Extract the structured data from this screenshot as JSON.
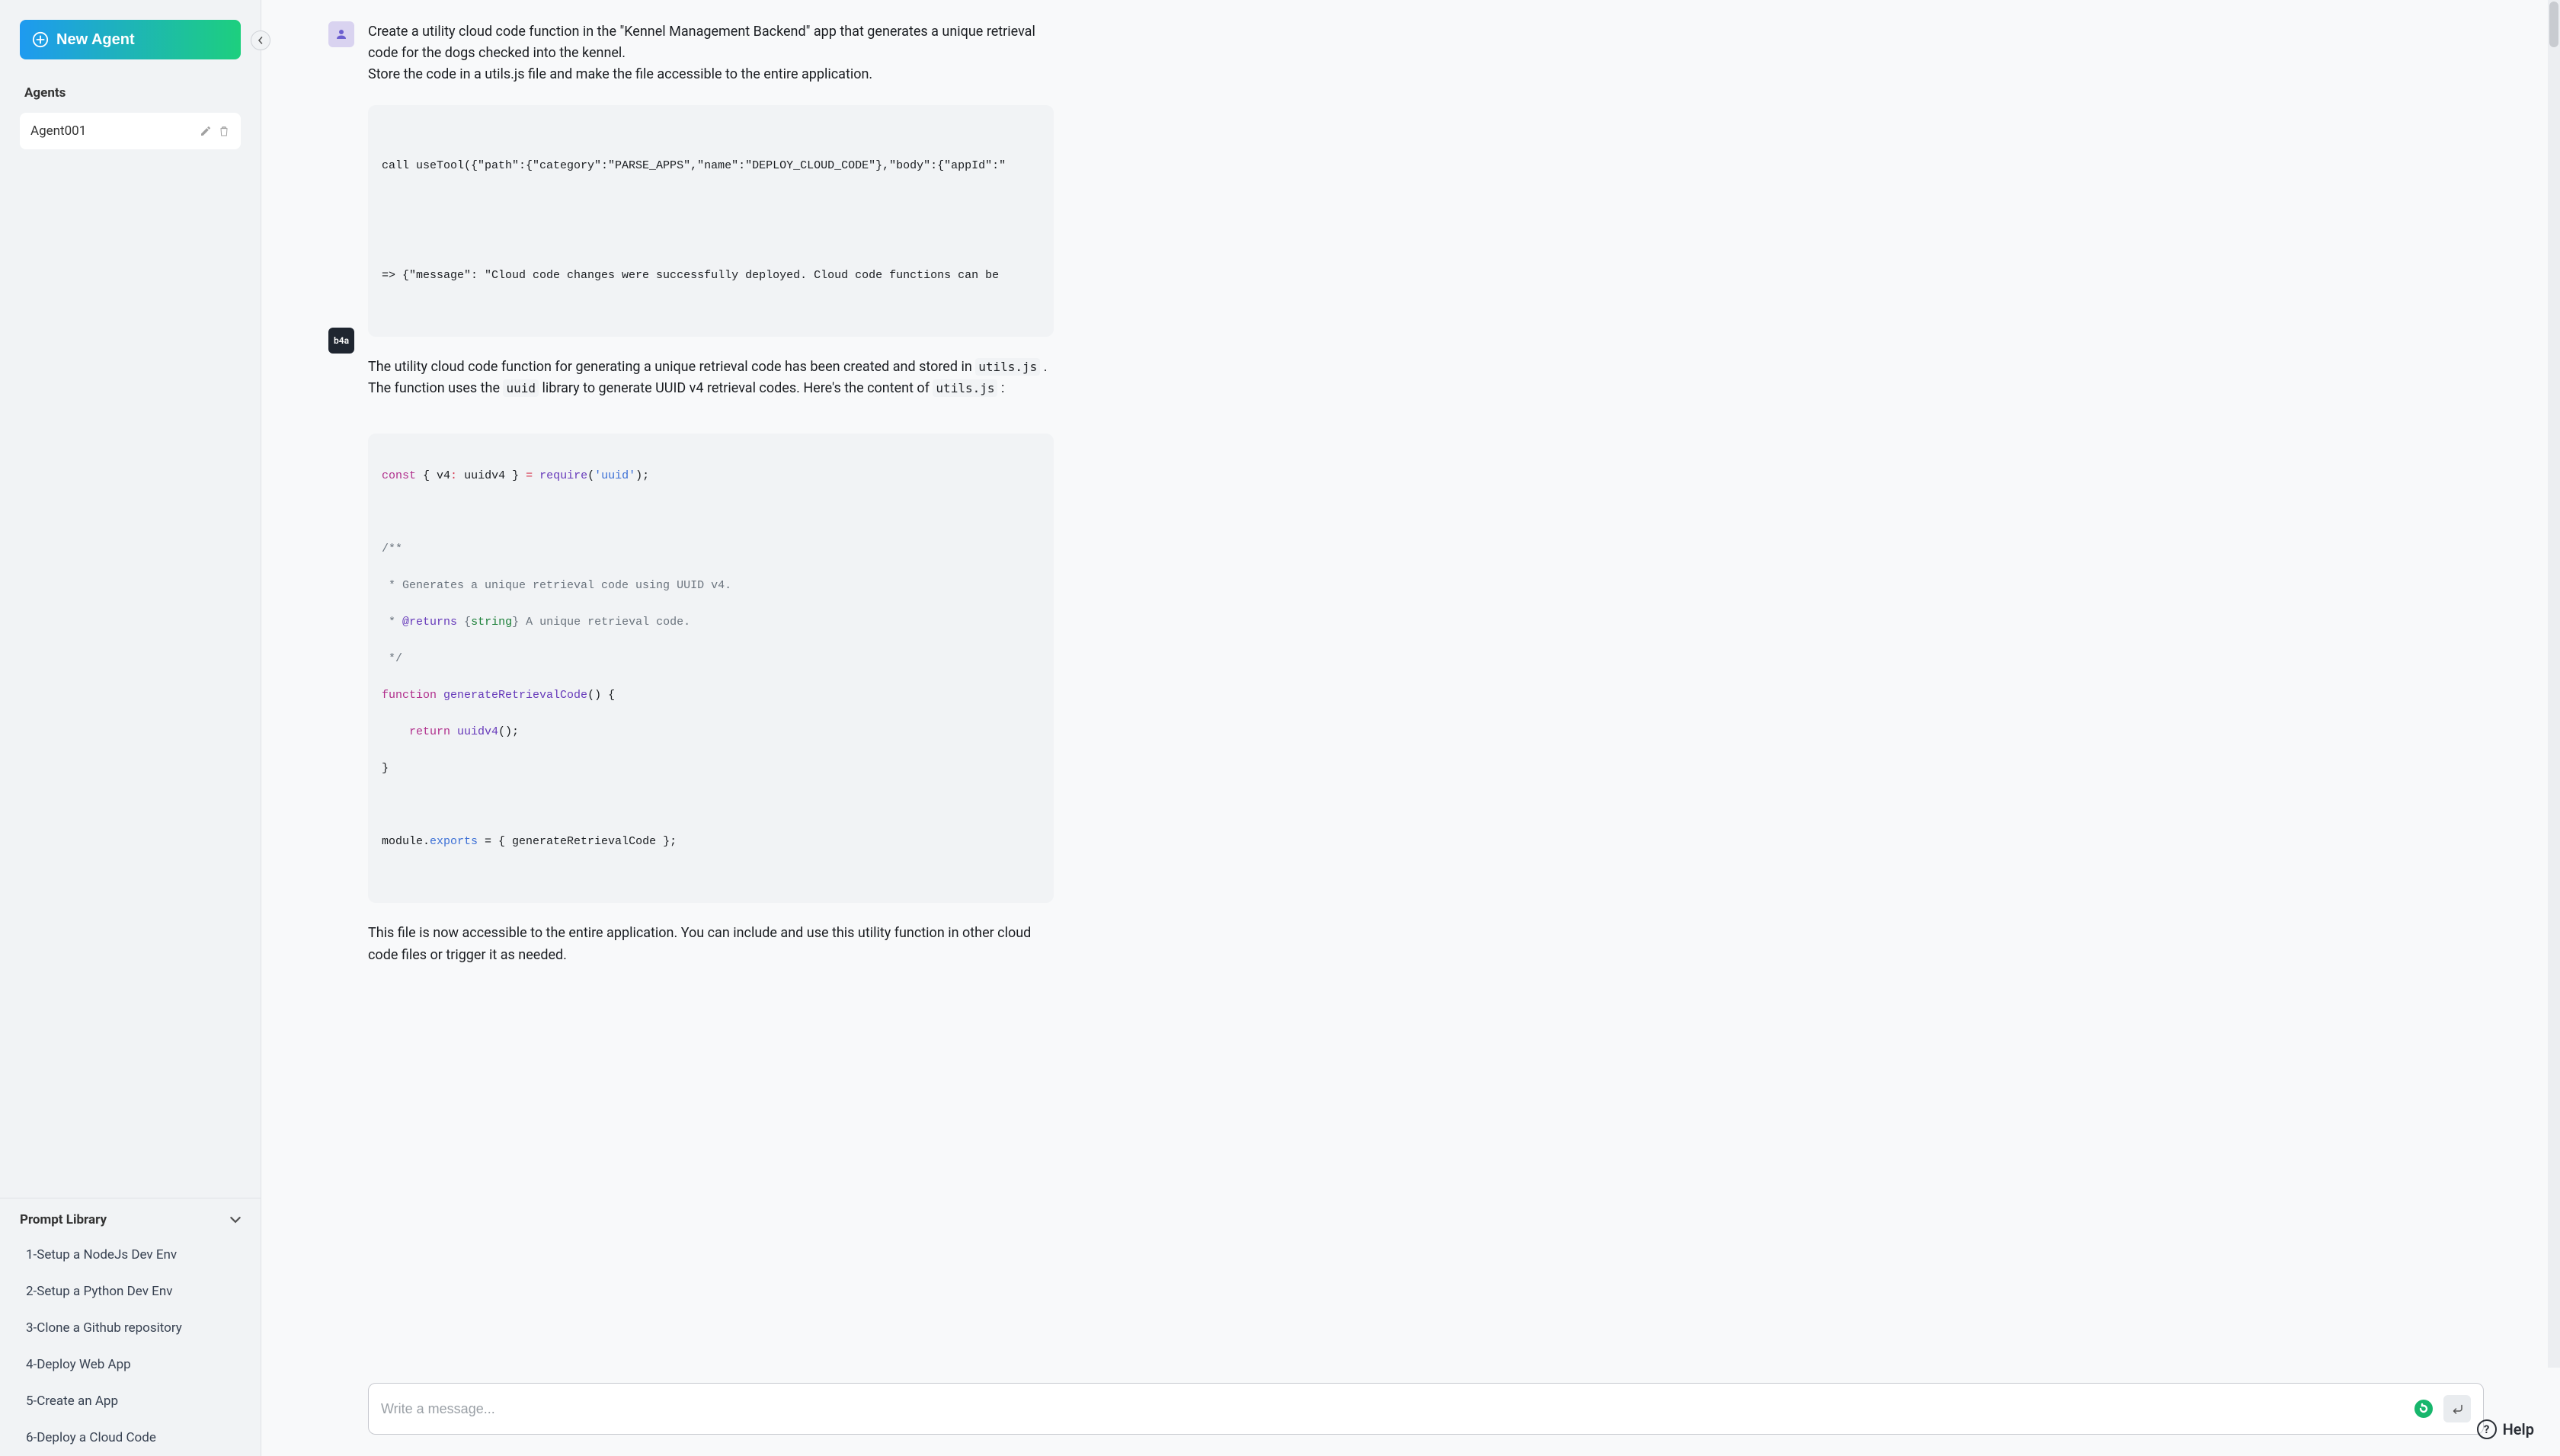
{
  "sidebar": {
    "new_agent_label": "New Agent",
    "agents_heading": "Agents",
    "agent_name": "Agent001"
  },
  "prompt_library": {
    "heading": "Prompt Library",
    "items": [
      "1-Setup a NodeJs Dev Env",
      "2-Setup a Python Dev Env",
      "3-Clone a Github repository",
      "4-Deploy Web App",
      "5-Create an App",
      "6-Deploy a Cloud Code"
    ]
  },
  "chat": {
    "user_msg_line1": "Create a utility cloud code function in the \"Kennel Management Backend\" app that generates a unique retrieval code for the dogs checked into the kennel.",
    "user_msg_line2": "Store the code in a utils.js file and make the file accessible to the entire application.",
    "b4a_label": "b4a",
    "code_tool": {
      "line1": "call useTool({\"path\":{\"category\":\"PARSE_APPS\",\"name\":\"DEPLOY_CLOUD_CODE\"},\"body\":{\"appId\":\"",
      "line2": "=> {\"message\": \"Cloud code changes were successfully deployed. Cloud code functions can be"
    },
    "assist_para1_a": "The utility cloud code function for generating a unique retrieval code has been created and stored in ",
    "assist_inline_utils1": "utils.js",
    "assist_para1_b": ". The function uses the ",
    "assist_inline_uuid": "uuid",
    "assist_para1_c": " library to generate UUID v4 retrieval codes. Here's the content of ",
    "assist_inline_utils2": "utils.js",
    "assist_para1_d": ":",
    "code_snippet": {
      "l1_const": "const",
      "l1_brace_open": " { ",
      "l1_v4": "v4",
      "l1_colon": ":",
      "l1_uuidv4": " uuidv4 } ",
      "l1_eq": "=",
      "l1_require": " require",
      "l1_paren": "(",
      "l1_str": "'uuid'",
      "l1_end": ");",
      "l3": "/**",
      "l4": " * Generates a unique retrieval code using UUID v4.",
      "l5_a": " * ",
      "l5_tag": "@returns",
      "l5_b": " ",
      "l5_brace": "{",
      "l5_type": "string",
      "l5_brace2": "}",
      "l5_c": " A unique retrieval code.",
      "l6": " */",
      "l7_fn": "function",
      "l7_name": " generateRetrievalCode",
      "l7_paren": "() {",
      "l8_ret": "    return",
      "l8_call": " uuidv4",
      "l8_end": "();",
      "l9": "}",
      "l11_a": "module.",
      "l11_exp": "exports",
      "l11_eq": " = { generateRetrievalCode };"
    },
    "assist_para2": "This file is now accessible to the entire application. You can include and use this utility function in other cloud code files or trigger it as needed."
  },
  "composer": {
    "placeholder": "Write a message..."
  },
  "help": {
    "label": "Help"
  }
}
